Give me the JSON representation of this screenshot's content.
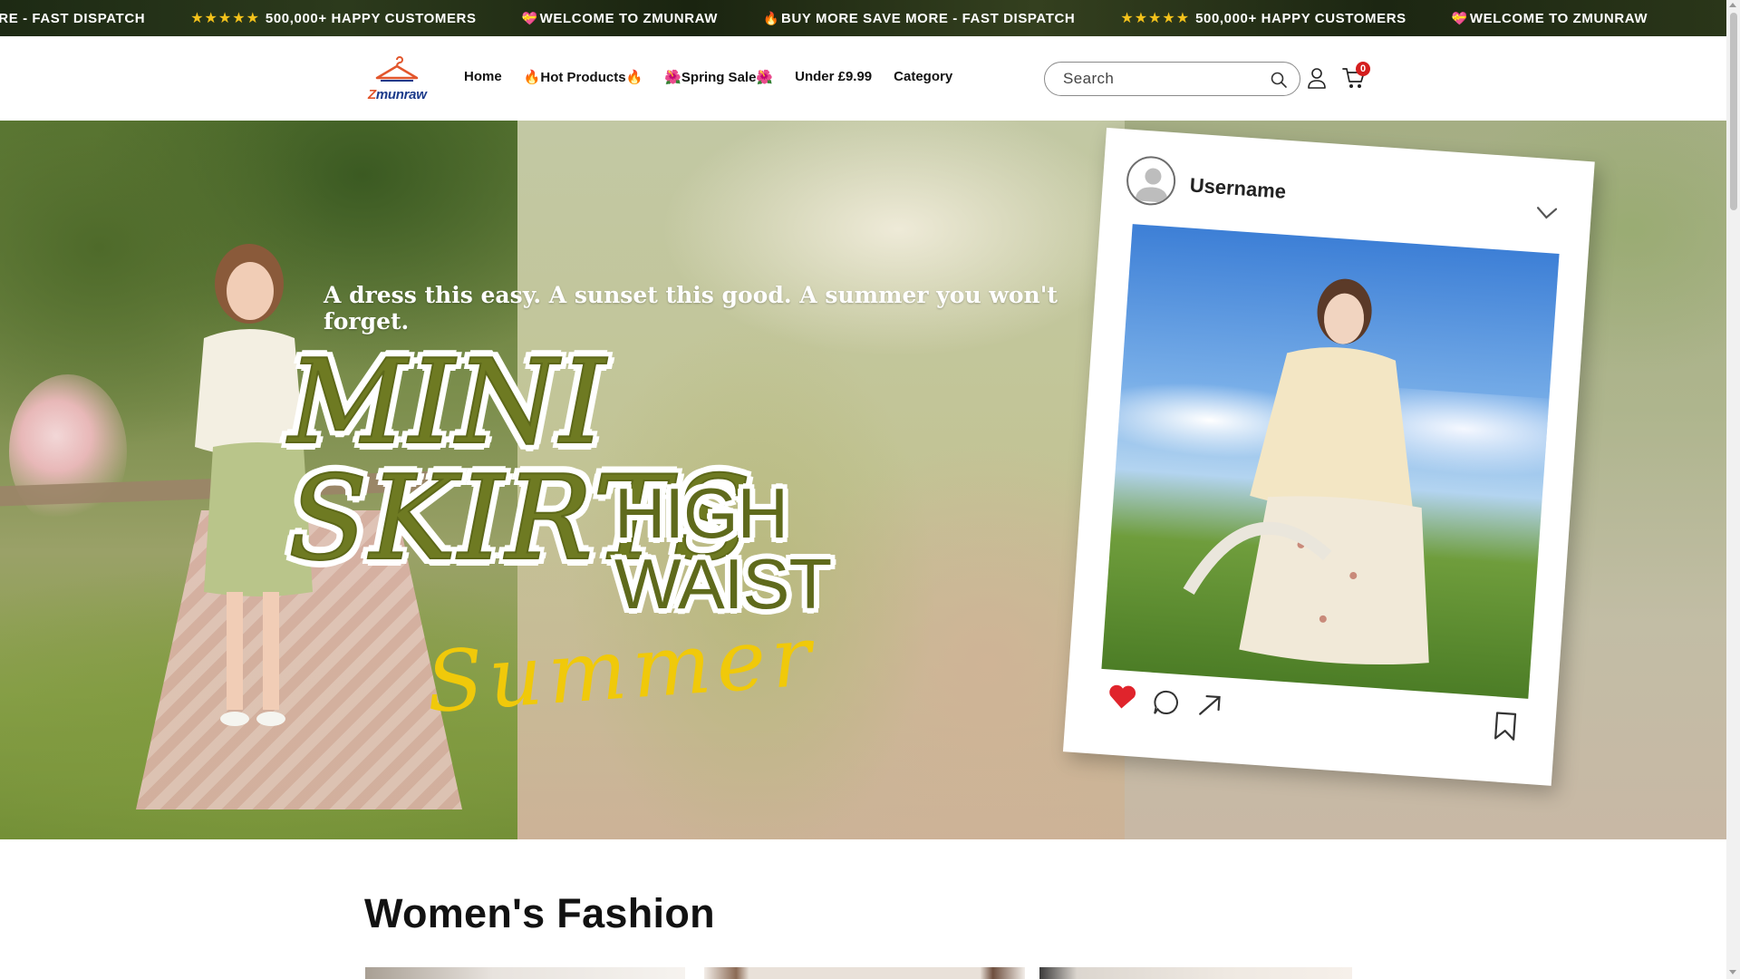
{
  "announcement": {
    "items": [
      {
        "icon": "none",
        "text": "ORE - FAST DISPATCH"
      },
      {
        "icon": "stars",
        "stars": "★★★★★",
        "text": "500,000+ HAPPY CUSTOMERS"
      },
      {
        "icon": "gift-heart-icon",
        "text": "WELCOME TO ZMUNRAW"
      },
      {
        "icon": "fire-icon",
        "text": "BUY MORE SAVE MORE - FAST DISPATCH"
      },
      {
        "icon": "stars",
        "stars": "★★★★★",
        "text": "500,000+ HAPPY CUSTOMERS"
      },
      {
        "icon": "gift-heart-icon",
        "text": "WELCOME TO ZMUNRAW"
      }
    ]
  },
  "header": {
    "logo_text_z": "Z",
    "logo_text_rest": "munraw",
    "nav": [
      {
        "label": "Home"
      },
      {
        "label": "🔥Hot Products🔥"
      },
      {
        "label": "🌺Spring Sale🌺"
      },
      {
        "label": "Under £9.99"
      },
      {
        "label": "Category"
      }
    ],
    "search_placeholder": "Search",
    "cart_count": "0"
  },
  "hero": {
    "tagline": "A dress this easy. A sunset this good. A summer you won't forget.",
    "title_line1": "MINI SKIRTS",
    "title_line2": "HIGH WAIST",
    "script_word": "Summer",
    "post": {
      "username": "Username"
    }
  },
  "section": {
    "title": "Women's Fashion"
  },
  "colors": {
    "accent_olive": "#6e7a22",
    "script_yellow": "#f0c90a",
    "badge_red": "#d41e1e",
    "announcement_stars": "#f4c21b"
  }
}
